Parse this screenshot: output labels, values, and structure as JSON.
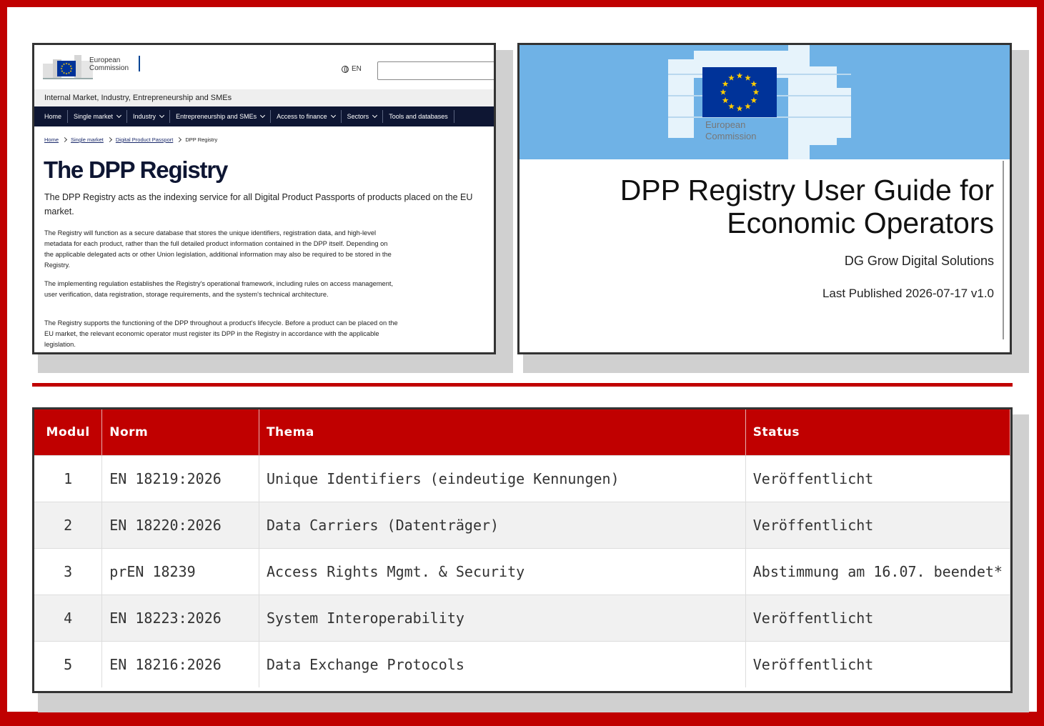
{
  "website": {
    "logo_text_line1": "European",
    "logo_text_line2": "Commission",
    "language": "EN",
    "search_placeholder": "",
    "site_title": "Internal Market, Industry, Entrepreneurship and SMEs",
    "nav": [
      {
        "label": "Home",
        "dropdown": false
      },
      {
        "label": "Single market",
        "dropdown": true
      },
      {
        "label": "Industry",
        "dropdown": true
      },
      {
        "label": "Entrepreneurship and SMEs",
        "dropdown": true
      },
      {
        "label": "Access to finance",
        "dropdown": true
      },
      {
        "label": "Sectors",
        "dropdown": true
      },
      {
        "label": "Tools and databases",
        "dropdown": false
      }
    ],
    "breadcrumbs": [
      "Home",
      "Single market",
      "Digital Product Passport",
      "DPP Registry"
    ],
    "title": "The DPP Registry",
    "lead": "The DPP Registry acts as the indexing service for all Digital Product Passports of products placed on the EU market.",
    "paragraphs": [
      "The Registry will function as a secure database that stores the unique identifiers, registration data, and high-level metadata for each product, rather than the full detailed product information contained in the DPP itself. Depending on the applicable delegated acts or other Union legislation, additional information may also be required to be stored in the Registry.",
      "The implementing regulation establishes the Registry's operational framework, including rules on access management, user verification, data registration, storage requirements, and the system's technical architecture.",
      "The Registry supports the functioning of the DPP throughout a product's lifecycle. Before a product can be placed on the EU market, the relevant economic operator must register its DPP in the Registry in accordance with the applicable legislation."
    ]
  },
  "guide": {
    "logo_text_line1": "European",
    "logo_text_line2": "Commission",
    "title_line1": "DPP Registry User Guide for",
    "title_line2": "Economic Operators",
    "subtitle": "DG Grow Digital Solutions",
    "published": "Last Published 2026-07-17 v1.0"
  },
  "table": {
    "headers": [
      "Modul",
      "Norm",
      "Thema",
      "Status"
    ],
    "rows": [
      [
        "1",
        "EN 18219:2026",
        "Unique Identifiers (eindeutige Kennungen)",
        "Veröffentlicht"
      ],
      [
        "2",
        "EN 18220:2026",
        "Data Carriers (Datenträger)",
        "Veröffentlicht"
      ],
      [
        "3",
        "prEN 18239",
        "Access Rights Mgmt. & Security",
        "Abstimmung am 16.07. beendet*"
      ],
      [
        "4",
        "EN 18223:2026",
        "System Interoperability",
        "Veröffentlicht"
      ],
      [
        "5",
        "EN 18216:2026",
        "Data Exchange Protocols",
        "Veröffentlicht"
      ]
    ]
  },
  "colors": {
    "accent": "#c00000",
    "ec_blue": "#003399",
    "nav_dark": "#0e1633",
    "flag_stars": "#ffcc00"
  }
}
